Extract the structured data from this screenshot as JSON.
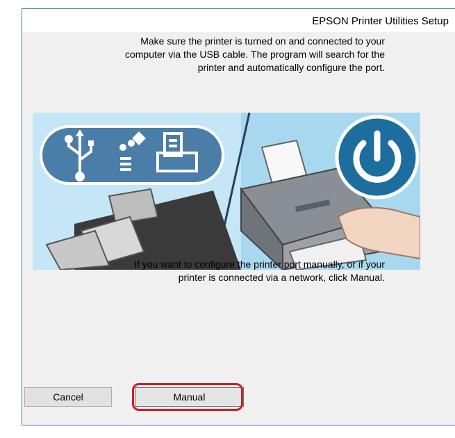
{
  "window": {
    "title": "EPSON Printer Utilities Setup"
  },
  "message_top": {
    "lines": [
      "Make sure the printer is turned on and connected to your",
      "computer via the USB cable. The program will search for the",
      ".printer and automatically configure the port"
    ]
  },
  "message_bottom": {
    "lines": [
      "If you want to configure the printer port manually, or if your",
      ".printer is connected via a network, click Manual"
    ]
  },
  "buttons": {
    "cancel_label": "Cancel",
    "manual_label": "Manual"
  },
  "icons": {
    "connection_icons": [
      "usb-icon",
      "firewire-icon",
      "network-printer-icon"
    ],
    "power_icon": "power-icon"
  },
  "colors": {
    "window_border": "#3c7fb1",
    "dialog_background": "#f0f0f0",
    "illustration_sky": "#a8d8f0",
    "icon_pill": "#4a7ea8",
    "power_button": "#1d6e9e",
    "highlight_outline": "#d71920"
  }
}
